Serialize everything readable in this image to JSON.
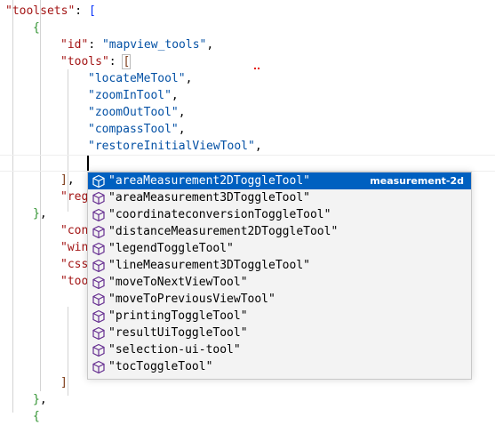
{
  "editor": {
    "lines": [
      {
        "indent": 0,
        "parts": [
          [
            "c-key",
            "\"toolsets\""
          ],
          [
            "c-punc",
            ": "
          ],
          [
            "c-b1",
            "["
          ]
        ]
      },
      {
        "indent": 1,
        "parts": [
          [
            "c-b2",
            "{"
          ]
        ]
      },
      {
        "indent": 2,
        "parts": [
          [
            "c-key",
            "\"id\""
          ],
          [
            "c-punc",
            ": "
          ],
          [
            "c-str",
            "\"mapview_tools\""
          ],
          [
            "c-punc",
            ","
          ]
        ]
      },
      {
        "indent": 2,
        "parts": [
          [
            "c-key",
            "\"tools\""
          ],
          [
            "c-punc",
            ": "
          ],
          [
            "c-b3",
            "["
          ]
        ]
      },
      {
        "indent": 3,
        "parts": [
          [
            "c-str",
            "\"locateMeTool\""
          ],
          [
            "c-punc",
            ","
          ]
        ]
      },
      {
        "indent": 3,
        "parts": [
          [
            "c-str",
            "\"zoomInTool\""
          ],
          [
            "c-punc",
            ","
          ]
        ]
      },
      {
        "indent": 3,
        "parts": [
          [
            "c-str",
            "\"zoomOutTool\""
          ],
          [
            "c-punc",
            ","
          ]
        ]
      },
      {
        "indent": 3,
        "parts": [
          [
            "c-str",
            "\"compassTool\""
          ],
          [
            "c-punc",
            ","
          ]
        ]
      },
      {
        "indent": 3,
        "parts": [
          [
            "c-str",
            "\"restoreInitialViewTool\""
          ],
          [
            "c-punc",
            ","
          ]
        ]
      },
      {
        "indent": 3,
        "parts": []
      },
      {
        "indent": 2,
        "parts": [
          [
            "c-b3",
            "]"
          ],
          [
            "c-punc",
            ","
          ]
        ]
      },
      {
        "indent": 2,
        "parts": [
          [
            "c-key",
            "\"reg"
          ]
        ]
      },
      {
        "indent": 1,
        "parts": [
          [
            "c-b2",
            "}"
          ],
          [
            "c-punc",
            ","
          ]
        ]
      },
      {
        "indent": 2,
        "parts": [
          [
            "c-key",
            "\"con"
          ]
        ]
      },
      {
        "indent": 2,
        "parts": [
          [
            "c-key",
            "\"win"
          ]
        ]
      },
      {
        "indent": 2,
        "parts": [
          [
            "c-key",
            "\"css"
          ]
        ]
      },
      {
        "indent": 2,
        "parts": [
          [
            "c-key",
            "\"too"
          ]
        ]
      },
      {
        "indent": 3,
        "parts": [
          [
            "c-b3",
            "["
          ]
        ]
      },
      {
        "indent": 3,
        "parts": []
      },
      {
        "indent": 3,
        "parts": []
      },
      {
        "indent": 3,
        "parts": []
      },
      {
        "indent": 3,
        "parts": []
      },
      {
        "indent": 2,
        "parts": [
          [
            "c-b3",
            "]"
          ]
        ]
      },
      {
        "indent": 1,
        "parts": [
          [
            "c-b2",
            "}"
          ],
          [
            "c-punc",
            ","
          ]
        ]
      },
      {
        "indent": 1,
        "parts": [
          [
            "c-b2",
            "{"
          ]
        ]
      }
    ]
  },
  "suggest": {
    "items": [
      {
        "label": "\"areaMeasurement2DToggleTool\"",
        "detail": "measurement-2d",
        "selected": true
      },
      {
        "label": "\"areaMeasurement3DToggleTool\""
      },
      {
        "label": "\"coordinateconversionToggleTool\""
      },
      {
        "label": "\"distanceMeasurement2DToggleTool\""
      },
      {
        "label": "\"legendToggleTool\""
      },
      {
        "label": "\"lineMeasurement3DToggleTool\""
      },
      {
        "label": "\"moveToNextViewTool\""
      },
      {
        "label": "\"moveToPreviousViewTool\""
      },
      {
        "label": "\"printingToggleTool\""
      },
      {
        "label": "\"resultUiToggleTool\""
      },
      {
        "label": "\"selection-ui-tool\""
      },
      {
        "label": "\"tocToggleTool\""
      }
    ],
    "item_icon": "cube-icon"
  }
}
